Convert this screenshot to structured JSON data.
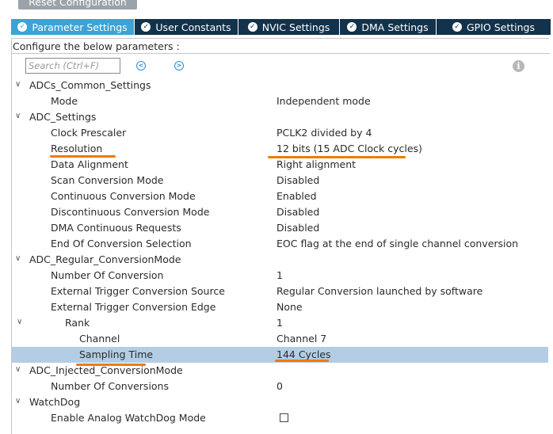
{
  "toolbar": {
    "reset_label": "Reset Configuration"
  },
  "tabs": [
    {
      "label": "Parameter Settings",
      "active": true
    },
    {
      "label": "User Constants",
      "active": false
    },
    {
      "label": "NVIC Settings",
      "active": false
    },
    {
      "label": "DMA Settings",
      "active": false
    },
    {
      "label": "GPIO Settings",
      "active": false
    }
  ],
  "configure_label": "Configure the below parameters :",
  "search": {
    "placeholder": "Search (Ctrl+F)"
  },
  "icons": {
    "prev": "chevron-left-icon",
    "next": "chevron-right-icon",
    "info": "info-icon",
    "check": "check-icon"
  },
  "colors": {
    "tab_active": "#3ba3d6",
    "tab_bar": "#13324b",
    "selection": "#b3cde4",
    "annotation": "#f07a00"
  },
  "tree": [
    {
      "label": "ADCs_Common_Settings",
      "value": "",
      "level": 0,
      "expandable": true
    },
    {
      "label": "Mode",
      "value": "Independent mode",
      "level": 1
    },
    {
      "label": "ADC_Settings",
      "value": "",
      "level": 0,
      "expandable": true
    },
    {
      "label": "Clock Prescaler",
      "value": "PCLK2 divided by 4",
      "level": 1
    },
    {
      "label": "Resolution",
      "value": "12 bits (15 ADC Clock cycles)",
      "level": 1
    },
    {
      "label": "Data Alignment",
      "value": "Right alignment",
      "level": 1
    },
    {
      "label": "Scan Conversion Mode",
      "value": "Disabled",
      "level": 1
    },
    {
      "label": "Continuous Conversion Mode",
      "value": "Enabled",
      "level": 1
    },
    {
      "label": "Discontinuous Conversion Mode",
      "value": "Disabled",
      "level": 1
    },
    {
      "label": "DMA Continuous Requests",
      "value": "Disabled",
      "level": 1
    },
    {
      "label": "End Of Conversion Selection",
      "value": "EOC flag at the end of single channel conversion",
      "level": 1
    },
    {
      "label": "ADC_Regular_ConversionMode",
      "value": "",
      "level": 0,
      "expandable": true
    },
    {
      "label": "Number Of Conversion",
      "value": "1",
      "level": 1
    },
    {
      "label": "External Trigger Conversion Source",
      "value": "Regular Conversion launched by software",
      "level": 1
    },
    {
      "label": "External Trigger Conversion Edge",
      "value": "None",
      "level": 1
    },
    {
      "label": "Rank",
      "value": "1",
      "level": 2,
      "expandable": true
    },
    {
      "label": "Channel",
      "value": "Channel 7",
      "level": 3
    },
    {
      "label": "Sampling Time",
      "value": "144 Cycles",
      "level": 3,
      "selected": true
    },
    {
      "label": "ADC_Injected_ConversionMode",
      "value": "",
      "level": 0,
      "expandable": true
    },
    {
      "label": "Number Of Conversions",
      "value": "0",
      "level": 1
    },
    {
      "label": "WatchDog",
      "value": "",
      "level": 0,
      "expandable": true
    },
    {
      "label": "Enable Analog WatchDog Mode",
      "value": "",
      "level": 1,
      "checkbox": true,
      "checked": false
    }
  ]
}
